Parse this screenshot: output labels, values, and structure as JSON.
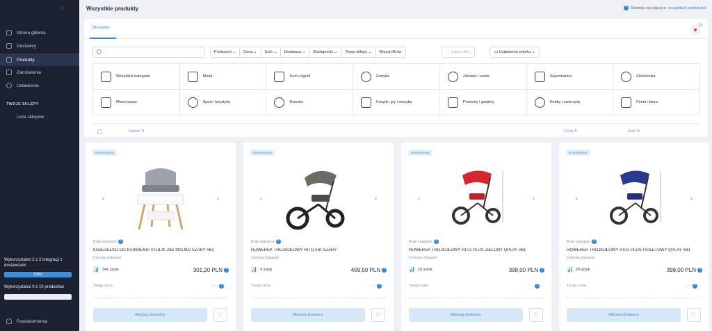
{
  "sidebar": {
    "collapse_icon": "‹",
    "items": [
      {
        "label": "Strona główna",
        "icon": "home-icon"
      },
      {
        "label": "Dostawcy",
        "icon": "suppliers-icon"
      },
      {
        "label": "Produkty",
        "icon": "products-icon"
      },
      {
        "label": "Zamówienia",
        "icon": "orders-icon"
      },
      {
        "label": "Ustawienia",
        "icon": "settings-icon"
      }
    ],
    "section_title": "TWOJE SKLEPY",
    "shop_item": "Lista sklepów",
    "usage1": {
      "text": "Wykorzystałeś 2 z 2 integracji z dostawcami",
      "bar_label": "100%",
      "percent": 100
    },
    "usage2": {
      "text": "Wykorzystałeś 0 z 10 produktów",
      "percent": 0
    },
    "notifications": "Powiadomienia"
  },
  "header": {
    "title": "Wszystkie produkty",
    "help_text": "Dowiedz się więcej o",
    "help_link": "wszystkich produktach"
  },
  "tabs": [
    "Wszystkie"
  ],
  "favorites_count": "0",
  "filters": [
    "Producent",
    "Cena",
    "Ilość",
    "Dostawca",
    "Dostępność",
    "Twoje sklepy",
    "Więcej filtrów"
  ],
  "save_filters": "Zapisz filtry",
  "view_settings": "Ustawienia widoku",
  "categories": [
    "Wszystkie kategorie",
    "Moda",
    "Dom i ogród",
    "Erotyka",
    "Zdrowie i uroda",
    "Supermarket",
    "Elektronika",
    "Motoryzacja",
    "Sport i turystyka",
    "Dziecko",
    "Książki, gry i muzyka",
    "Prezenty i gadżety",
    "Hobby i zwierzęta",
    "Firma i biuro"
  ],
  "table_header": {
    "name": "Nazwa",
    "price": "Cena",
    "qty": "Ilość"
  },
  "products": [
    {
      "tag": "Dropshipping",
      "category": "Brak kategorii",
      "title": "KRZESEŁKO DO KARMIENIA STOLIK 2w1 MALMO SZARY #B1",
      "supplier": "Centrala Zabawek",
      "stock": "341 sztuk",
      "price": "301,20 PLN",
      "your_price_label": "Twoja cena",
      "your_price": "- - -",
      "button": "Aktywuj dostawcę"
    },
    {
      "tag": "Dropshipping",
      "category": "Brak kategorii",
      "title": "ROWEREK TRÓJKOŁOWY RITO AIR SZARY",
      "supplier": "Centrala Zabawek",
      "stock": "9 sztuk",
      "price": "409,50 PLN",
      "your_price_label": "Twoja cena",
      "your_price": "- - -",
      "button": "Aktywuj dostawcę"
    },
    {
      "tag": "Dropshipping",
      "category": "Brak kategorii",
      "title": "ROWEREK TRÓJKOŁOWY RITO PLUS ZIELONY QPLAY #B1",
      "supplier": "Centrala Zabawek",
      "stock": "15 sztuk",
      "price": "398,00 PLN",
      "your_price_label": "Twoja cena",
      "your_price": "- - -",
      "button": "Aktywuj dostawcę"
    },
    {
      "tag": "Dropshipping",
      "category": "Brak kategorii",
      "title": "ROWEREK TRÓJKOŁOWY RITO PLUS FIOLETOWY QPLAY #B1",
      "supplier": "Centrala Zabawek",
      "stock": "20 sztuk",
      "price": "398,00 PLN",
      "your_price_label": "Twoja cena",
      "your_price": "- - -",
      "button": "Aktywuj dostawcę"
    }
  ],
  "colors": {
    "accent": "#2f86d8",
    "sidebar": "#1c2131",
    "heart": "#e23a5a"
  }
}
